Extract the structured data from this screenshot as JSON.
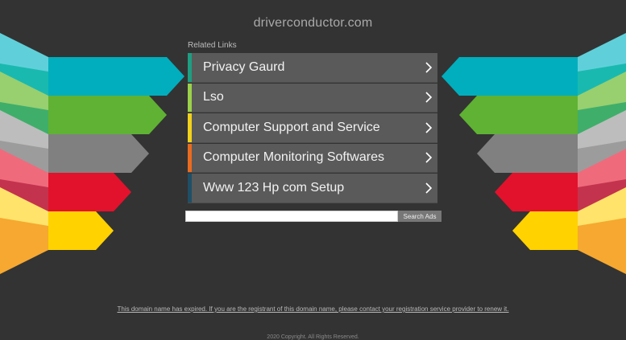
{
  "header": {
    "domain": "driverconductor.com"
  },
  "related": {
    "heading": "Related Links",
    "links": [
      {
        "label": "Privacy Gaurd",
        "color": "#1e9e82"
      },
      {
        "label": "Lso",
        "color": "#9bd14b"
      },
      {
        "label": "Computer Support and Service",
        "color": "#f2d21b"
      },
      {
        "label": "Computer Monitoring Softwares",
        "color": "#ea6b1f"
      },
      {
        "label": "Www 123 Hp com Setup",
        "color": "#1f4f66"
      }
    ]
  },
  "search": {
    "value": "",
    "button_label": "Search Ads"
  },
  "footer": {
    "notice": "This domain name has expired. If you are the registrant of this domain name, please contact your registration service provider to renew it.",
    "copyright": "2020 Copyright. All Rights Reserved."
  },
  "palette": {
    "background": "#333333",
    "arrows": [
      "#00aebd",
      "#5fb233",
      "#808080",
      "#e2122c",
      "#ffd200"
    ],
    "arrows_light": [
      "#5fd0da",
      "#98cf6f",
      "#bdbdbd",
      "#ef6b7c",
      "#ffe36a"
    ],
    "arrows_mid": [
      "#1ab9b0",
      "#3fae6a",
      "#9c9c9c",
      "#c4334d",
      "#f6a830"
    ]
  }
}
